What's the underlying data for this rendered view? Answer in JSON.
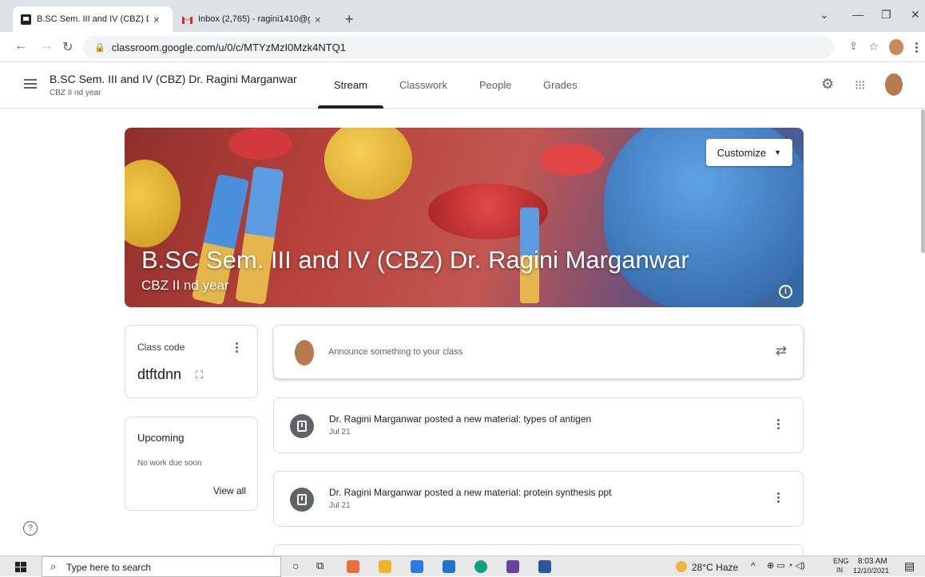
{
  "browser": {
    "tabs": [
      {
        "title": "B.SC Sem. III and IV (CBZ) Dr. Ragini Marganwar",
        "close": "×",
        "active": true
      },
      {
        "title": "Inbox (2,765) - ragini1410@gmail.com",
        "close": "×",
        "active": false
      }
    ],
    "new_tab": "+",
    "url": "classroom.google.com/u/0/c/MTYzMzI0Mzk4NTQ1"
  },
  "header": {
    "class_name": "B.SC Sem. III and IV (CBZ) Dr. Ragini Marganwar",
    "class_section": "CBZ II nd year",
    "tabs": [
      {
        "label": "Stream",
        "active": true
      },
      {
        "label": "Classwork",
        "active": false
      },
      {
        "label": "People",
        "active": false
      },
      {
        "label": "Grades",
        "active": false
      }
    ]
  },
  "banner": {
    "title": "B.SC Sem. III and IV (CBZ) Dr. Ragini Marganwar",
    "subtitle": "CBZ II nd year",
    "customize_label": "Customize"
  },
  "class_code": {
    "label": "Class code",
    "code": "dtftdnn"
  },
  "upcoming": {
    "title": "Upcoming",
    "empty_text": "No work due soon",
    "view_all": "View all"
  },
  "announce": {
    "placeholder": "Announce something to your class"
  },
  "posts": [
    {
      "text": "Dr. Ragini Marganwar posted a new material: types of antigen",
      "date": "Jul 21"
    },
    {
      "text": "Dr. Ragini Marganwar posted a new material: protein synthesis ppt",
      "date": "Jul 21"
    }
  ],
  "taskbar": {
    "search_placeholder": "Type here to search",
    "weather": "28°C Haze",
    "lang": "ENG",
    "region": "IN",
    "time": "8:03 AM",
    "date": "12/10/2021"
  },
  "colors": {
    "accent": "#202124",
    "tab_bar": "#dee1e6",
    "icon_grey": "#5f6368",
    "border": "#dadce0"
  }
}
